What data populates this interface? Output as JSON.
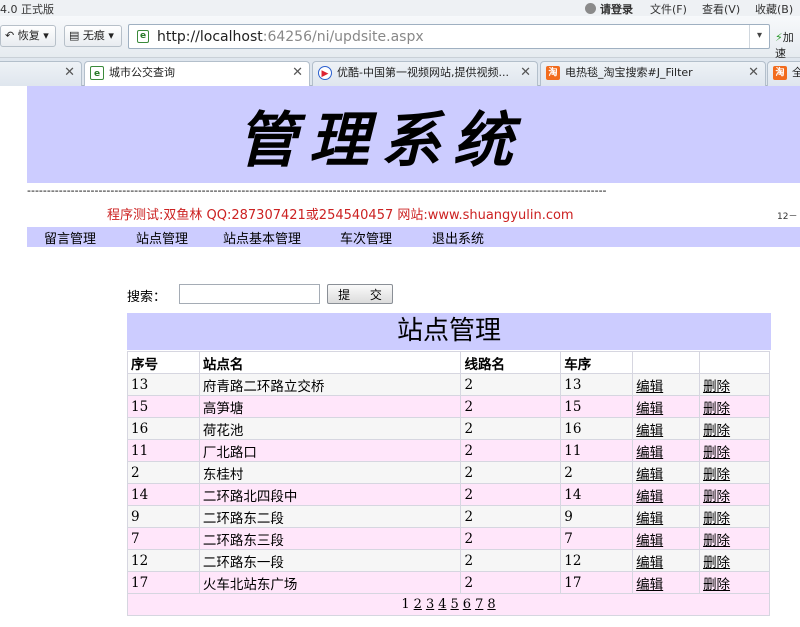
{
  "browser": {
    "version_text": "4.0 正式版",
    "login": "请登录",
    "menu": [
      "文件(F)",
      "查看(V)",
      "收藏(B)"
    ],
    "back_label": "恢复",
    "mode_label": "无痕",
    "url_host": "http://localhost",
    "url_rest": ":64256/ni/updsite.aspx",
    "speed_label": "加速",
    "tabs": [
      {
        "label": "城市公交查询"
      },
      {
        "label": "优酷-中国第一视频网站,提供视频..."
      },
      {
        "label": "电热毯_淘宝搜索#J_Filter"
      },
      {
        "label": "全"
      }
    ]
  },
  "header": {
    "title": "管理系统",
    "dashes": "--------------------------------------------------------------------------------------------------------------------------------------------------",
    "info": "程序测试:双鱼林 QQ:287307421或254540457 网站:www.shuangyulin.com",
    "date": "12－"
  },
  "nav": [
    "留言管理",
    "站点管理",
    "站点基本管理",
    "车次管理",
    "退出系统"
  ],
  "search": {
    "label": "搜索：",
    "value": "",
    "button": "提 交"
  },
  "grid": {
    "title": "站点管理",
    "headers": [
      "序号",
      "站点名",
      "线路名",
      "车序",
      "",
      ""
    ],
    "edit_label": "编辑",
    "delete_label": "删除",
    "rows": [
      [
        "13",
        "府青路二环路立交桥",
        "2",
        "13"
      ],
      [
        "15",
        "高笋塘",
        "2",
        "15"
      ],
      [
        "16",
        "荷花池",
        "2",
        "16"
      ],
      [
        "11",
        "厂北路口",
        "2",
        "11"
      ],
      [
        "2",
        "东桂村",
        "2",
        "2"
      ],
      [
        "14",
        "二环路北四段中",
        "2",
        "14"
      ],
      [
        "9",
        "二环路东二段",
        "2",
        "9"
      ],
      [
        "7",
        "二环路东三段",
        "2",
        "7"
      ],
      [
        "12",
        "二环路东一段",
        "2",
        "12"
      ],
      [
        "17",
        "火车北站东广场",
        "2",
        "17"
      ]
    ],
    "pages": [
      "1",
      "2",
      "3",
      "4",
      "5",
      "6",
      "7",
      "8"
    ],
    "current_page": "1"
  }
}
